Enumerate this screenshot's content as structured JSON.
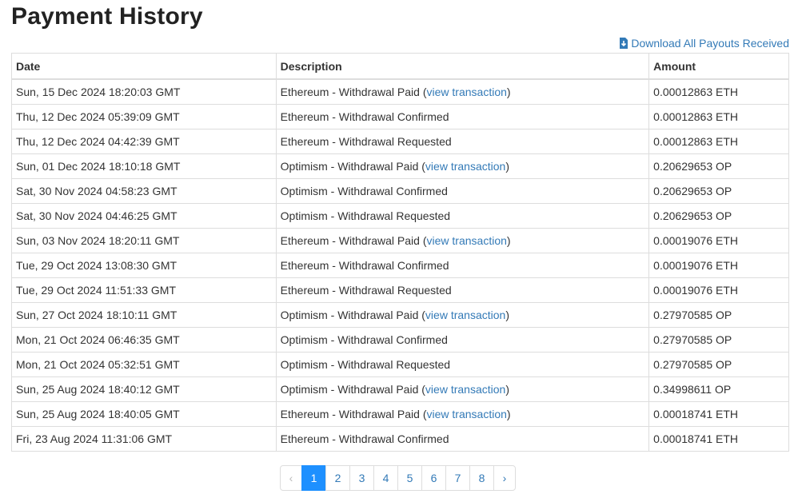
{
  "page": {
    "title": "Payment History",
    "download_label": "Download All Payouts Received",
    "download_icon": "download-icon"
  },
  "table": {
    "headers": {
      "date": "Date",
      "description": "Description",
      "amount": "Amount"
    },
    "rows": [
      {
        "date": "Sun, 15 Dec 2024 18:20:03 GMT",
        "description": "Ethereum - Withdrawal Paid",
        "link": "view transaction",
        "amount": "0.00012863 ETH"
      },
      {
        "date": "Thu, 12 Dec 2024 05:39:09 GMT",
        "description": "Ethereum - Withdrawal Confirmed",
        "link": "",
        "amount": "0.00012863 ETH"
      },
      {
        "date": "Thu, 12 Dec 2024 04:42:39 GMT",
        "description": "Ethereum - Withdrawal Requested",
        "link": "",
        "amount": "0.00012863 ETH"
      },
      {
        "date": "Sun, 01 Dec 2024 18:10:18 GMT",
        "description": "Optimism - Withdrawal Paid",
        "link": "view transaction",
        "amount": "0.20629653 OP"
      },
      {
        "date": "Sat, 30 Nov 2024 04:58:23 GMT",
        "description": "Optimism - Withdrawal Confirmed",
        "link": "",
        "amount": "0.20629653 OP"
      },
      {
        "date": "Sat, 30 Nov 2024 04:46:25 GMT",
        "description": "Optimism - Withdrawal Requested",
        "link": "",
        "amount": "0.20629653 OP"
      },
      {
        "date": "Sun, 03 Nov 2024 18:20:11 GMT",
        "description": "Ethereum - Withdrawal Paid",
        "link": "view transaction",
        "amount": "0.00019076 ETH"
      },
      {
        "date": "Tue, 29 Oct 2024 13:08:30 GMT",
        "description": "Ethereum - Withdrawal Confirmed",
        "link": "",
        "amount": "0.00019076 ETH"
      },
      {
        "date": "Tue, 29 Oct 2024 11:51:33 GMT",
        "description": "Ethereum - Withdrawal Requested",
        "link": "",
        "amount": "0.00019076 ETH"
      },
      {
        "date": "Sun, 27 Oct 2024 18:10:11 GMT",
        "description": "Optimism - Withdrawal Paid",
        "link": "view transaction",
        "amount": "0.27970585 OP"
      },
      {
        "date": "Mon, 21 Oct 2024 06:46:35 GMT",
        "description": "Optimism - Withdrawal Confirmed",
        "link": "",
        "amount": "0.27970585 OP"
      },
      {
        "date": "Mon, 21 Oct 2024 05:32:51 GMT",
        "description": "Optimism - Withdrawal Requested",
        "link": "",
        "amount": "0.27970585 OP"
      },
      {
        "date": "Sun, 25 Aug 2024 18:40:12 GMT",
        "description": "Optimism - Withdrawal Paid",
        "link": "view transaction",
        "amount": "0.34998611 OP"
      },
      {
        "date": "Sun, 25 Aug 2024 18:40:05 GMT",
        "description": "Ethereum - Withdrawal Paid",
        "link": "view transaction",
        "amount": "0.00018741 ETH"
      },
      {
        "date": "Fri, 23 Aug 2024 11:31:06 GMT",
        "description": "Ethereum - Withdrawal Confirmed",
        "link": "",
        "amount": "0.00018741 ETH"
      }
    ]
  },
  "pagination": {
    "prev": "‹",
    "next": "›",
    "pages": [
      "1",
      "2",
      "3",
      "4",
      "5",
      "6",
      "7",
      "8"
    ],
    "active": "1"
  },
  "colors": {
    "link": "#337ab7",
    "active_page": "#1e90ff",
    "border": "#dddddd"
  }
}
